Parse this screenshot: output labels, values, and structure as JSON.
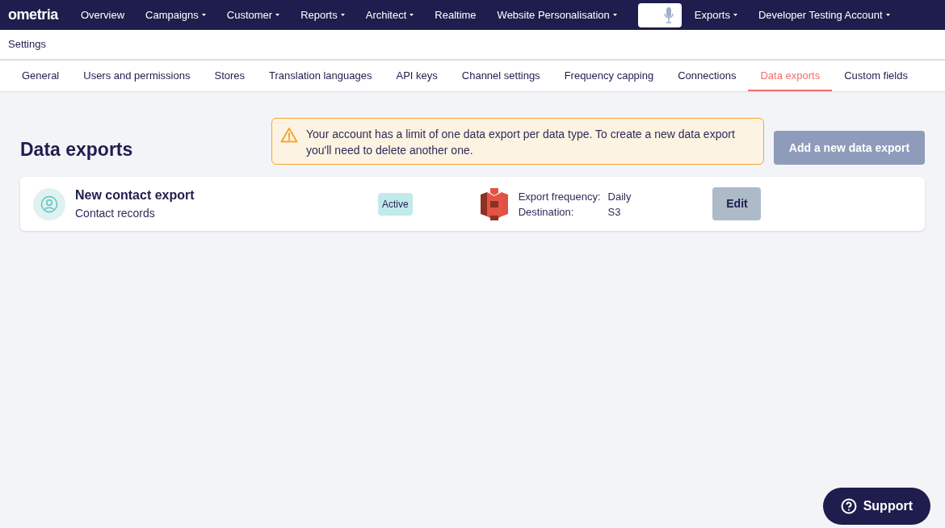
{
  "nav": {
    "logo": "ometria",
    "items": [
      {
        "label": "Overview",
        "dropdown": false
      },
      {
        "label": "Campaigns",
        "dropdown": true
      },
      {
        "label": "Customer",
        "dropdown": true
      },
      {
        "label": "Reports",
        "dropdown": true
      },
      {
        "label": "Architect",
        "dropdown": true
      },
      {
        "label": "Realtime",
        "dropdown": false
      },
      {
        "label": "Website Personalisation",
        "dropdown": true
      }
    ],
    "right_items": [
      {
        "label": "Exports",
        "dropdown": true
      },
      {
        "label": "Developer Testing Account",
        "dropdown": true
      }
    ]
  },
  "breadcrumb": "Settings",
  "tabs": [
    {
      "label": "General",
      "selected": false
    },
    {
      "label": "Users and permissions",
      "selected": false
    },
    {
      "label": "Stores",
      "selected": false
    },
    {
      "label": "Translation languages",
      "selected": false
    },
    {
      "label": "API keys",
      "selected": false
    },
    {
      "label": "Channel settings",
      "selected": false
    },
    {
      "label": "Frequency capping",
      "selected": false
    },
    {
      "label": "Connections",
      "selected": false
    },
    {
      "label": "Data exports",
      "selected": true
    },
    {
      "label": "Custom fields",
      "selected": false
    }
  ],
  "page_title": "Data exports",
  "warning": "Your account has a limit of one data export per data type. To create a new data export you'll need to delete another one.",
  "add_button": {
    "label": "Add a new data export",
    "disabled": true
  },
  "exports": [
    {
      "name": "New contact export",
      "subtitle": "Contact records",
      "status": "Active",
      "details": [
        {
          "label": "Export frequency:",
          "value": "Daily"
        },
        {
          "label": "Destination:",
          "value": "S3"
        }
      ],
      "action": "Edit"
    }
  ],
  "support_button": "Support"
}
